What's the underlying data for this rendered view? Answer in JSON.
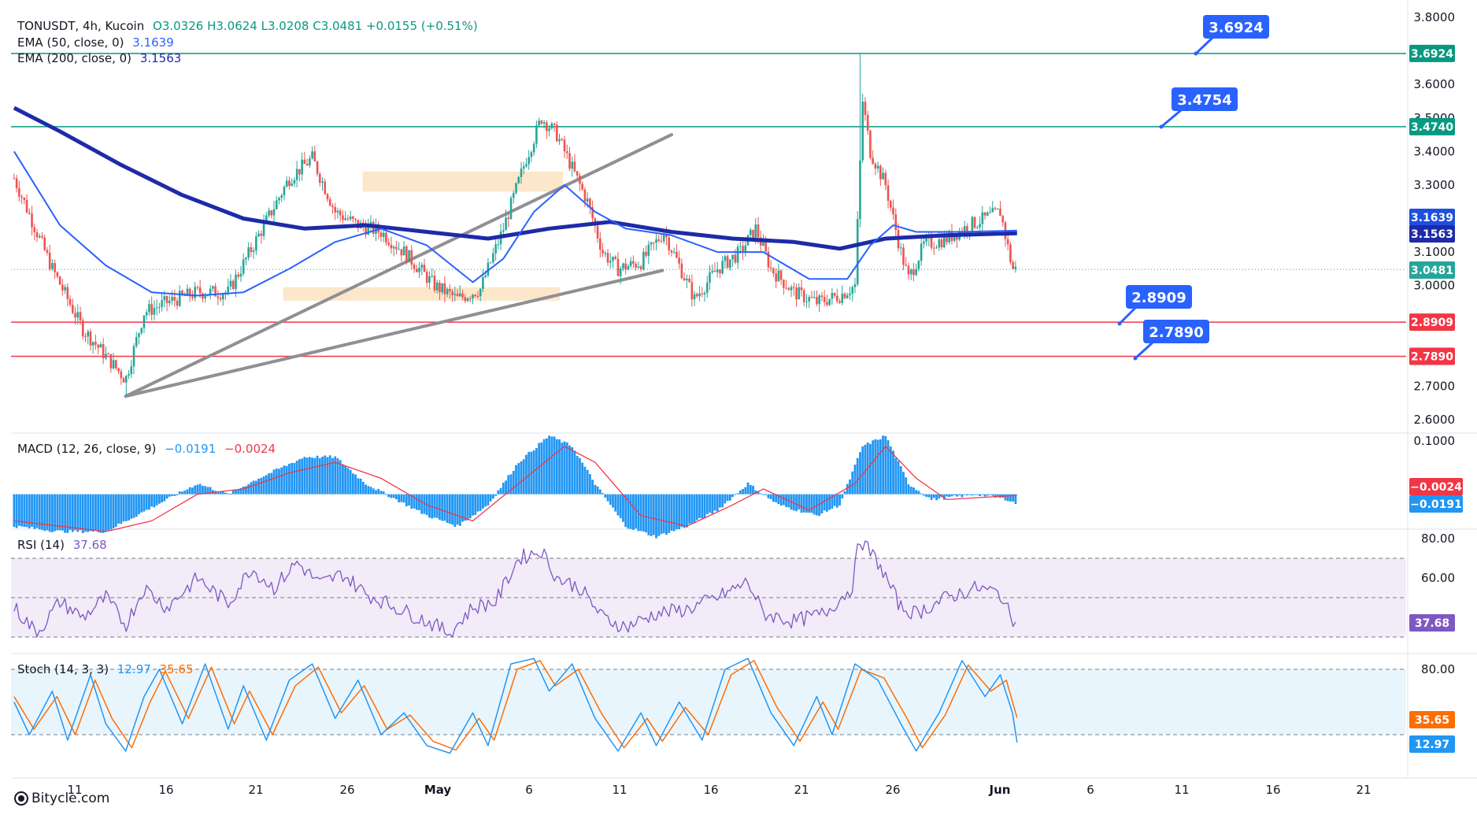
{
  "legend": {
    "symbol": "TONUSDT, 4h, Kucoin",
    "ohlc": "O3.0326  H3.0624  L3.0208  C3.0481  +0.0155 (+0.51%)",
    "ema50_label": "EMA (50, close, 0)",
    "ema50_value": "3.1639",
    "ema200_label": "EMA (200, close, 0)",
    "ema200_value": "3.1563",
    "macd_label": "MACD (12, 26, close, 9)",
    "macd_value": "−0.0191",
    "signal_value": "−0.0024",
    "rsi_label": "RSI (14)",
    "rsi_value": "37.68",
    "stoch_label": "Stoch (14, 3, 3)",
    "stoch_k_value": "12.97",
    "stoch_d_value": "35.65"
  },
  "footer": {
    "brand": "Bitycle.com"
  },
  "colors": {
    "up": "#26a69a",
    "down": "#ef5350",
    "ema50": "#2962ff",
    "ema200": "#1d2ba8",
    "resistance": "#089981",
    "support": "#f23645",
    "trend": "#8f8f94",
    "zone": "#fbe3c2",
    "callout": "#2962ff",
    "macd_hist": "#2196f3",
    "signal": "#f23645",
    "rsi": "#7e57c2",
    "stoch_k": "#2196f3",
    "stoch_d": "#ff6d00"
  },
  "chart_data": {
    "type": "candlestick",
    "symbol": "TONUSDT",
    "timeframe": "4h",
    "exchange": "Kucoin",
    "x_ticks": [
      "11",
      "16",
      "21",
      "26",
      "May",
      "6",
      "11",
      "16",
      "21",
      "26",
      "Jun",
      "6",
      "11",
      "16",
      "21"
    ],
    "price_axis": {
      "range": [
        2.55,
        3.85
      ],
      "ticks": [
        "3.8000",
        "3.6000",
        "3.5000",
        "3.4000",
        "3.3000",
        "3.1000",
        "3.0000",
        "2.7000",
        "2.6000"
      ]
    },
    "last_price": "3.0481",
    "horizontal_levels": [
      {
        "value": "3.6924",
        "type": "resistance"
      },
      {
        "value": "3.4740",
        "type": "resistance"
      },
      {
        "value": "2.8909",
        "type": "support"
      },
      {
        "value": "2.7890",
        "type": "support"
      }
    ],
    "callouts": [
      "3.6924",
      "3.4754",
      "2.8909",
      "2.7890"
    ],
    "ema_tags": [
      "3.1639",
      "3.1563"
    ],
    "trendlines": [
      {
        "from": {
          "day": 14.3,
          "price": 2.67
        },
        "to": {
          "day": 50.0,
          "price": 3.45
        }
      },
      {
        "from": {
          "day": 14.3,
          "price": 2.67
        },
        "to": {
          "day": 49.4,
          "price": 3.045
        }
      }
    ],
    "zones": [
      {
        "x_days": [
          29.8,
          42.9
        ],
        "price": [
          3.28,
          3.34
        ]
      },
      {
        "x_days": [
          24.6,
          42.7
        ],
        "price": [
          2.955,
          2.995
        ]
      }
    ],
    "price_path_days": [
      [
        7.0,
        3.32
      ],
      [
        9.5,
        3.05
      ],
      [
        11.5,
        2.87
      ],
      [
        14.3,
        2.72
      ],
      [
        15.5,
        2.92
      ],
      [
        17.0,
        2.95
      ],
      [
        19.0,
        2.98
      ],
      [
        21.0,
        2.98
      ],
      [
        23.0,
        3.15
      ],
      [
        25.0,
        3.32
      ],
      [
        26.5,
        3.38
      ],
      [
        28.0,
        3.22
      ],
      [
        29.5,
        3.18
      ],
      [
        31.0,
        3.16
      ],
      [
        32.5,
        3.1
      ],
      [
        34.5,
        3.0
      ],
      [
        36.0,
        2.96
      ],
      [
        37.5,
        2.99
      ],
      [
        39.0,
        3.17
      ],
      [
        40.5,
        3.38
      ],
      [
        41.5,
        3.5
      ],
      [
        42.5,
        3.45
      ],
      [
        43.5,
        3.35
      ],
      [
        44.5,
        3.25
      ],
      [
        45.5,
        3.1
      ],
      [
        46.5,
        3.05
      ],
      [
        48.0,
        3.07
      ],
      [
        49.5,
        3.16
      ],
      [
        50.5,
        3.06
      ],
      [
        51.5,
        2.96
      ],
      [
        53.0,
        3.05
      ],
      [
        54.5,
        3.1
      ],
      [
        55.5,
        3.17
      ],
      [
        56.5,
        3.05
      ],
      [
        58.0,
        2.98
      ],
      [
        59.5,
        2.95
      ],
      [
        61.0,
        2.97
      ],
      [
        62.0,
        3.0
      ],
      [
        62.5,
        3.55
      ],
      [
        63.0,
        3.4
      ],
      [
        64.0,
        3.3
      ],
      [
        65.0,
        3.1
      ],
      [
        65.5,
        3.02
      ],
      [
        66.5,
        3.12
      ],
      [
        68.0,
        3.14
      ],
      [
        69.5,
        3.18
      ],
      [
        70.5,
        3.2
      ],
      [
        71.5,
        3.22
      ],
      [
        72.3,
        3.05
      ],
      [
        72.6,
        3.048
      ]
    ],
    "ema50_days": [
      [
        7.0,
        3.4
      ],
      [
        10.0,
        3.18
      ],
      [
        13.0,
        3.06
      ],
      [
        16.0,
        2.98
      ],
      [
        19.0,
        2.97
      ],
      [
        22.0,
        2.98
      ],
      [
        25.0,
        3.05
      ],
      [
        28.0,
        3.13
      ],
      [
        31.0,
        3.17
      ],
      [
        34.0,
        3.12
      ],
      [
        37.0,
        3.01
      ],
      [
        39.0,
        3.08
      ],
      [
        41.0,
        3.22
      ],
      [
        43.0,
        3.3
      ],
      [
        45.0,
        3.22
      ],
      [
        47.0,
        3.17
      ],
      [
        50.0,
        3.15
      ],
      [
        53.0,
        3.1
      ],
      [
        56.0,
        3.1
      ],
      [
        59.0,
        3.02
      ],
      [
        61.5,
        3.02
      ],
      [
        63.0,
        3.12
      ],
      [
        64.5,
        3.18
      ],
      [
        66.0,
        3.16
      ],
      [
        69.0,
        3.16
      ],
      [
        72.6,
        3.164
      ]
    ],
    "ema200_days": [
      [
        7.0,
        3.53
      ],
      [
        10.0,
        3.46
      ],
      [
        14.0,
        3.36
      ],
      [
        18.0,
        3.27
      ],
      [
        22.0,
        3.2
      ],
      [
        26.0,
        3.17
      ],
      [
        30.0,
        3.18
      ],
      [
        34.0,
        3.16
      ],
      [
        38.0,
        3.14
      ],
      [
        42.0,
        3.17
      ],
      [
        46.0,
        3.19
      ],
      [
        50.0,
        3.16
      ],
      [
        54.0,
        3.14
      ],
      [
        58.0,
        3.13
      ],
      [
        61.0,
        3.11
      ],
      [
        64.0,
        3.14
      ],
      [
        68.0,
        3.15
      ],
      [
        72.6,
        3.156
      ]
    ],
    "macd": {
      "label": "MACD (12, 26, close, 9)",
      "range": [
        -0.09,
        0.13
      ],
      "ticks": [
        "0.1000"
      ],
      "histogram_days": [
        [
          7.0,
          -0.06
        ],
        [
          10.0,
          -0.07
        ],
        [
          13.0,
          -0.07
        ],
        [
          15.0,
          -0.04
        ],
        [
          17.0,
          -0.01
        ],
        [
          19.0,
          0.02
        ],
        [
          21.0,
          0.0
        ],
        [
          23.0,
          0.03
        ],
        [
          26.0,
          0.07
        ],
        [
          28.0,
          0.07
        ],
        [
          30.0,
          0.02
        ],
        [
          32.0,
          -0.01
        ],
        [
          34.0,
          -0.04
        ],
        [
          36.0,
          -0.06
        ],
        [
          38.0,
          -0.02
        ],
        [
          40.0,
          0.06
        ],
        [
          42.0,
          0.11
        ],
        [
          43.5,
          0.09
        ],
        [
          45.0,
          0.02
        ],
        [
          47.0,
          -0.06
        ],
        [
          49.0,
          -0.08
        ],
        [
          51.0,
          -0.06
        ],
        [
          53.0,
          -0.03
        ],
        [
          55.0,
          0.02
        ],
        [
          57.0,
          -0.02
        ],
        [
          59.5,
          -0.04
        ],
        [
          61.0,
          -0.02
        ],
        [
          62.5,
          0.09
        ],
        [
          64.0,
          0.11
        ],
        [
          65.5,
          0.02
        ],
        [
          67.0,
          -0.01
        ],
        [
          70.0,
          0.0
        ],
        [
          72.0,
          -0.01
        ],
        [
          72.6,
          -0.019
        ]
      ],
      "signal_days": [
        [
          7.0,
          -0.05
        ],
        [
          10.0,
          -0.06
        ],
        [
          13.0,
          -0.07
        ],
        [
          16.0,
          -0.05
        ],
        [
          19.0,
          0.0
        ],
        [
          22.0,
          0.01
        ],
        [
          25.0,
          0.04
        ],
        [
          28.0,
          0.06
        ],
        [
          31.0,
          0.03
        ],
        [
          34.0,
          -0.02
        ],
        [
          37.0,
          -0.05
        ],
        [
          40.0,
          0.02
        ],
        [
          43.0,
          0.09
        ],
        [
          45.0,
          0.06
        ],
        [
          48.0,
          -0.04
        ],
        [
          51.0,
          -0.06
        ],
        [
          54.0,
          -0.02
        ],
        [
          56.0,
          0.01
        ],
        [
          59.0,
          -0.03
        ],
        [
          62.0,
          0.02
        ],
        [
          64.0,
          0.09
        ],
        [
          66.0,
          0.03
        ],
        [
          68.0,
          -0.01
        ],
        [
          72.6,
          -0.002
        ]
      ],
      "tags": [
        "−0.0024",
        "−0.0191"
      ]
    },
    "rsi": {
      "label": "RSI (14)",
      "value": "37.68",
      "range": [
        28,
        82
      ],
      "band": [
        30,
        70
      ],
      "mid": 50,
      "ticks": [
        "80.00",
        "60.00"
      ],
      "series_days": [
        [
          7.0,
          45
        ],
        [
          8.5,
          32
        ],
        [
          10.0,
          48
        ],
        [
          11.5,
          40
        ],
        [
          13.0,
          50
        ],
        [
          14.3,
          36
        ],
        [
          15.5,
          55
        ],
        [
          17.0,
          45
        ],
        [
          19.0,
          60
        ],
        [
          21.0,
          47
        ],
        [
          22.5,
          65
        ],
        [
          24.0,
          55
        ],
        [
          25.5,
          68
        ],
        [
          27.0,
          57
        ],
        [
          28.5,
          62
        ],
        [
          30.0,
          52
        ],
        [
          32.0,
          45
        ],
        [
          34.0,
          38
        ],
        [
          35.5,
          32
        ],
        [
          37.0,
          45
        ],
        [
          38.5,
          48
        ],
        [
          40.0,
          70
        ],
        [
          41.5,
          74
        ],
        [
          42.5,
          60
        ],
        [
          44.0,
          55
        ],
        [
          45.5,
          40
        ],
        [
          47.0,
          35
        ],
        [
          49.0,
          42
        ],
        [
          51.0,
          44
        ],
        [
          53.0,
          50
        ],
        [
          55.0,
          58
        ],
        [
          56.0,
          42
        ],
        [
          58.0,
          38
        ],
        [
          60.0,
          42
        ],
        [
          61.8,
          55
        ],
        [
          62.3,
          80
        ],
        [
          63.5,
          68
        ],
        [
          65.0,
          45
        ],
        [
          66.0,
          42
        ],
        [
          68.0,
          50
        ],
        [
          70.0,
          55
        ],
        [
          71.5,
          52
        ],
        [
          72.3,
          38
        ],
        [
          72.6,
          37.68
        ]
      ]
    },
    "stoch": {
      "label": "Stoch (14, 3, 3)",
      "k_value": "12.97",
      "d_value": "35.65",
      "range": [
        0,
        95
      ],
      "band": [
        20,
        80
      ],
      "ticks": [
        "80.00"
      ],
      "k_days": [
        [
          7.0,
          50
        ],
        [
          8.0,
          20
        ],
        [
          9.5,
          60
        ],
        [
          10.5,
          15
        ],
        [
          12.0,
          75
        ],
        [
          13.0,
          30
        ],
        [
          14.3,
          5
        ],
        [
          15.5,
          55
        ],
        [
          16.5,
          80
        ],
        [
          18.0,
          30
        ],
        [
          19.5,
          85
        ],
        [
          21.0,
          25
        ],
        [
          22.0,
          65
        ],
        [
          23.5,
          15
        ],
        [
          25.0,
          70
        ],
        [
          26.5,
          85
        ],
        [
          28.0,
          35
        ],
        [
          29.5,
          70
        ],
        [
          31.0,
          20
        ],
        [
          32.5,
          40
        ],
        [
          34.0,
          10
        ],
        [
          35.5,
          3
        ],
        [
          37.0,
          40
        ],
        [
          38.0,
          10
        ],
        [
          39.5,
          85
        ],
        [
          41.0,
          90
        ],
        [
          42.0,
          60
        ],
        [
          43.5,
          85
        ],
        [
          45.0,
          35
        ],
        [
          46.5,
          5
        ],
        [
          48.0,
          40
        ],
        [
          49.0,
          10
        ],
        [
          50.5,
          50
        ],
        [
          52.0,
          15
        ],
        [
          53.5,
          80
        ],
        [
          55.0,
          90
        ],
        [
          56.5,
          40
        ],
        [
          58.0,
          10
        ],
        [
          59.5,
          55
        ],
        [
          60.5,
          20
        ],
        [
          62.0,
          85
        ],
        [
          63.5,
          70
        ],
        [
          65.0,
          30
        ],
        [
          66.0,
          5
        ],
        [
          67.5,
          40
        ],
        [
          69.0,
          88
        ],
        [
          70.5,
          55
        ],
        [
          71.5,
          75
        ],
        [
          72.3,
          40
        ],
        [
          72.6,
          12.97
        ]
      ],
      "d_days": [
        [
          7.0,
          55
        ],
        [
          8.3,
          25
        ],
        [
          9.8,
          55
        ],
        [
          11.0,
          20
        ],
        [
          12.3,
          70
        ],
        [
          13.4,
          35
        ],
        [
          14.7,
          8
        ],
        [
          15.9,
          50
        ],
        [
          16.9,
          78
        ],
        [
          18.4,
          35
        ],
        [
          19.9,
          82
        ],
        [
          21.4,
          30
        ],
        [
          22.4,
          60
        ],
        [
          23.9,
          20
        ],
        [
          25.4,
          65
        ],
        [
          26.9,
          82
        ],
        [
          28.4,
          40
        ],
        [
          29.9,
          65
        ],
        [
          31.4,
          25
        ],
        [
          32.9,
          38
        ],
        [
          34.4,
          14
        ],
        [
          35.9,
          6
        ],
        [
          37.4,
          35
        ],
        [
          38.4,
          15
        ],
        [
          39.9,
          80
        ],
        [
          41.4,
          88
        ],
        [
          42.4,
          65
        ],
        [
          43.9,
          80
        ],
        [
          45.4,
          40
        ],
        [
          46.9,
          8
        ],
        [
          48.4,
          35
        ],
        [
          49.4,
          14
        ],
        [
          50.9,
          45
        ],
        [
          52.4,
          20
        ],
        [
          53.9,
          75
        ],
        [
          55.4,
          88
        ],
        [
          56.9,
          45
        ],
        [
          58.4,
          14
        ],
        [
          59.9,
          50
        ],
        [
          60.9,
          25
        ],
        [
          62.4,
          80
        ],
        [
          63.9,
          72
        ],
        [
          65.4,
          35
        ],
        [
          66.4,
          8
        ],
        [
          67.9,
          38
        ],
        [
          69.4,
          84
        ],
        [
          70.9,
          60
        ],
        [
          71.9,
          70
        ],
        [
          72.6,
          35.65
        ]
      ],
      "tags": [
        "35.65",
        "12.97"
      ]
    }
  }
}
